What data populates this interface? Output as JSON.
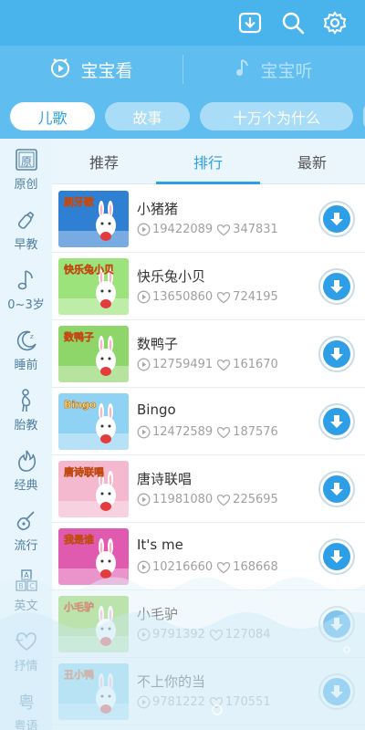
{
  "colors": {
    "topbar": "#49b3ec",
    "tabs_bg": "#5fbdf0",
    "accent": "#2d9fe6",
    "download_blue": "#2e9ee6"
  },
  "topbar": {
    "icons": [
      "download-box-icon",
      "search-icon",
      "gear-icon"
    ]
  },
  "main_tabs": [
    {
      "label": "宝宝看",
      "icon": "play-clock-icon",
      "active": true
    },
    {
      "label": "宝宝听",
      "icon": "music-note-icon",
      "active": false
    }
  ],
  "categories": [
    {
      "label": "儿歌",
      "active": true
    },
    {
      "label": "故事",
      "active": false
    },
    {
      "label": "十万个为什么",
      "active": false
    }
  ],
  "sidebar": {
    "items": [
      {
        "label": "原创",
        "icon": "original-badge-icon"
      },
      {
        "label": "早教",
        "icon": "milk-bottle-icon"
      },
      {
        "label": "0~3岁",
        "icon": "music-note-icon"
      },
      {
        "label": "睡前",
        "icon": "moon-icon"
      },
      {
        "label": "胎教",
        "icon": "pregnant-icon"
      },
      {
        "label": "经典",
        "icon": "flame-icon"
      },
      {
        "label": "流行",
        "icon": "guitar-icon"
      },
      {
        "label": "英文",
        "icon": "abc-blocks-icon"
      },
      {
        "label": "抒情",
        "icon": "heart-icon"
      },
      {
        "label": "粤语",
        "icon": "cantonese-icon"
      }
    ]
  },
  "sub_tabs": [
    {
      "label": "推荐",
      "active": false
    },
    {
      "label": "排行",
      "active": true
    },
    {
      "label": "最新",
      "active": false
    }
  ],
  "songs": [
    {
      "title": "小猪猪",
      "plays": "19422089",
      "likes": "347831",
      "thumb_text": "刷牙歌",
      "thumb_color": "#2f7fd3"
    },
    {
      "title": "快乐兔小贝",
      "plays": "13650860",
      "likes": "724195",
      "thumb_text": "快乐兔小贝",
      "thumb_color": "#9be37a"
    },
    {
      "title": "数鸭子",
      "plays": "12759491",
      "likes": "161670",
      "thumb_text": "数鸭子",
      "thumb_color": "#8fd66a"
    },
    {
      "title": "Bingo",
      "plays": "12472589",
      "likes": "187576",
      "thumb_text": "Bingo",
      "thumb_color": "#8fd2f3"
    },
    {
      "title": "唐诗联唱",
      "plays": "11981080",
      "likes": "225695",
      "thumb_text": "唐诗联唱",
      "thumb_color": "#f4b9cf"
    },
    {
      "title": "It's me",
      "plays": "10216660",
      "likes": "168668",
      "thumb_text": "我是谁",
      "thumb_color": "#e05bb0"
    },
    {
      "title": "小毛驴",
      "plays": "9791392",
      "likes": "127084",
      "thumb_text": "小毛驴",
      "thumb_color": "#9fd86b"
    },
    {
      "title": "不上你的当",
      "plays": "9781222",
      "likes": "170551",
      "thumb_text": "丑小鸭",
      "thumb_color": "#7fd0ee"
    }
  ]
}
